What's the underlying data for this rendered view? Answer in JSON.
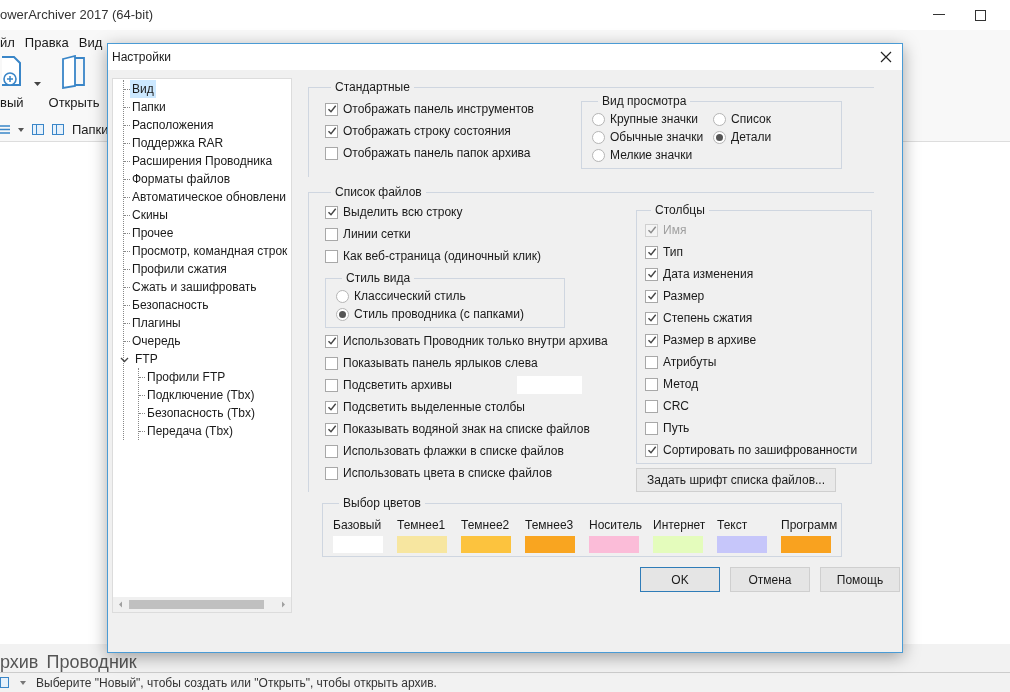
{
  "app": {
    "title": "owerArchiver 2017 (64-bit)",
    "menu": [
      "йл",
      "Правка",
      "Вид"
    ],
    "toolbar": [
      {
        "label": "вый",
        "kind": "new"
      },
      {
        "label": "Открыть",
        "kind": "open"
      }
    ],
    "folders_label": "Папки",
    "view_tabs": [
      "рхив",
      "Проводник"
    ],
    "status": "Выберите \"Новый\", чтобы создать или \"Открыть\", чтобы открыть архив."
  },
  "dialog": {
    "title": "Настройки",
    "tree": [
      {
        "label": "Вид",
        "selected": true
      },
      {
        "label": "Папки",
        "selected": false
      },
      {
        "label": "Расположения",
        "selected": false
      },
      {
        "label": "Поддержка RAR",
        "selected": false
      },
      {
        "label": "Расширения Проводника",
        "selected": false
      },
      {
        "label": "Форматы файлов",
        "selected": false
      },
      {
        "label": "Автоматическое обновлени",
        "selected": false
      },
      {
        "label": "Скины",
        "selected": false
      },
      {
        "label": "Прочее",
        "selected": false
      },
      {
        "label": "Просмотр, командная строк",
        "selected": false
      },
      {
        "label": "Профили сжатия",
        "selected": false
      },
      {
        "label": "Сжать и зашифровать",
        "selected": false
      },
      {
        "label": "Безопасность",
        "selected": false
      },
      {
        "label": "Плагины",
        "selected": false
      },
      {
        "label": "Очередь",
        "selected": false
      },
      {
        "label": "FTP",
        "selected": false,
        "expanded": true,
        "children": [
          {
            "label": "Профили FTP",
            "selected": false
          },
          {
            "label": "Подключение (Tbx)",
            "selected": false
          },
          {
            "label": "Безопасность (Tbx)",
            "selected": false
          },
          {
            "label": "Передача (Tbx)",
            "selected": false
          }
        ]
      }
    ],
    "standard": {
      "title": "Стандартные",
      "options": [
        {
          "label": "Отображать панель инструментов",
          "checked": true
        },
        {
          "label": "Отображать строку состояния",
          "checked": true
        },
        {
          "label": "Отображать панель папок архива",
          "checked": false
        }
      ]
    },
    "view_mode": {
      "title": "Вид просмотра",
      "options": [
        {
          "label": "Крупные значки",
          "selected": false
        },
        {
          "label": "Список",
          "selected": false
        },
        {
          "label": "Обычные значки",
          "selected": false
        },
        {
          "label": "Детали",
          "selected": true
        },
        {
          "label": "Мелкие значки",
          "selected": false
        }
      ]
    },
    "file_list": {
      "title": "Список файлов",
      "options_top": [
        {
          "label": "Выделить всю строку",
          "checked": true
        },
        {
          "label": "Линии сетки",
          "checked": false
        },
        {
          "label": "Как веб-страница (одиночный клик)",
          "checked": false
        }
      ],
      "style": {
        "title": "Стиль вида",
        "options": [
          {
            "label": "Классический стиль",
            "selected": false
          },
          {
            "label": "Стиль проводника (с папками)",
            "selected": true
          }
        ]
      },
      "options_bottom": [
        {
          "label": "Использовать Проводник только внутри архива",
          "checked": true
        },
        {
          "label": "Показывать панель ярлыков слева",
          "checked": false
        },
        {
          "label": "Подсветить архивы",
          "checked": false,
          "color": "#ffffff"
        },
        {
          "label": "Подсветить выделенные столбы",
          "checked": true
        },
        {
          "label": "Показывать водяной знак на списке файлов",
          "checked": true
        },
        {
          "label": "Использовать флажки в списке файлов",
          "checked": false
        },
        {
          "label": "Использовать цвета в списке файлов",
          "checked": false
        }
      ],
      "columns": {
        "title": "Столбцы",
        "options": [
          {
            "label": "Имя",
            "checked": true,
            "disabled": true
          },
          {
            "label": "Тип",
            "checked": true,
            "disabled": false
          },
          {
            "label": "Дата изменения",
            "checked": true,
            "disabled": false
          },
          {
            "label": "Размер",
            "checked": true,
            "disabled": false
          },
          {
            "label": "Степень сжатия",
            "checked": true,
            "disabled": false
          },
          {
            "label": "Размер в архиве",
            "checked": true,
            "disabled": false
          },
          {
            "label": "Атрибуты",
            "checked": false,
            "disabled": false
          },
          {
            "label": "Метод",
            "checked": false,
            "disabled": false
          },
          {
            "label": "CRC",
            "checked": false,
            "disabled": false
          },
          {
            "label": "Путь",
            "checked": false,
            "disabled": false
          },
          {
            "label": "Сортировать по зашифрованности",
            "checked": true,
            "disabled": false
          }
        ]
      },
      "font_button": "Задать шрифт списка файлов..."
    },
    "colors": {
      "title": "Выбор цветов",
      "items": [
        {
          "label": "Базовый",
          "color": "#ffffff"
        },
        {
          "label": "Темнее1",
          "color": "#f7e6a0"
        },
        {
          "label": "Темнее2",
          "color": "#fcc33e"
        },
        {
          "label": "Темнее3",
          "color": "#f9a520"
        },
        {
          "label": "Носитель",
          "color": "#fbbcd8"
        },
        {
          "label": "Интернет",
          "color": "#e4fcbc"
        },
        {
          "label": "Текст",
          "color": "#c6c6fa"
        },
        {
          "label": "Программ",
          "color": "#f9a21f"
        }
      ]
    },
    "buttons": [
      {
        "label": "OK",
        "focused": true
      },
      {
        "label": "Отмена",
        "focused": false
      },
      {
        "label": "Помощь",
        "focused": false
      }
    ]
  }
}
